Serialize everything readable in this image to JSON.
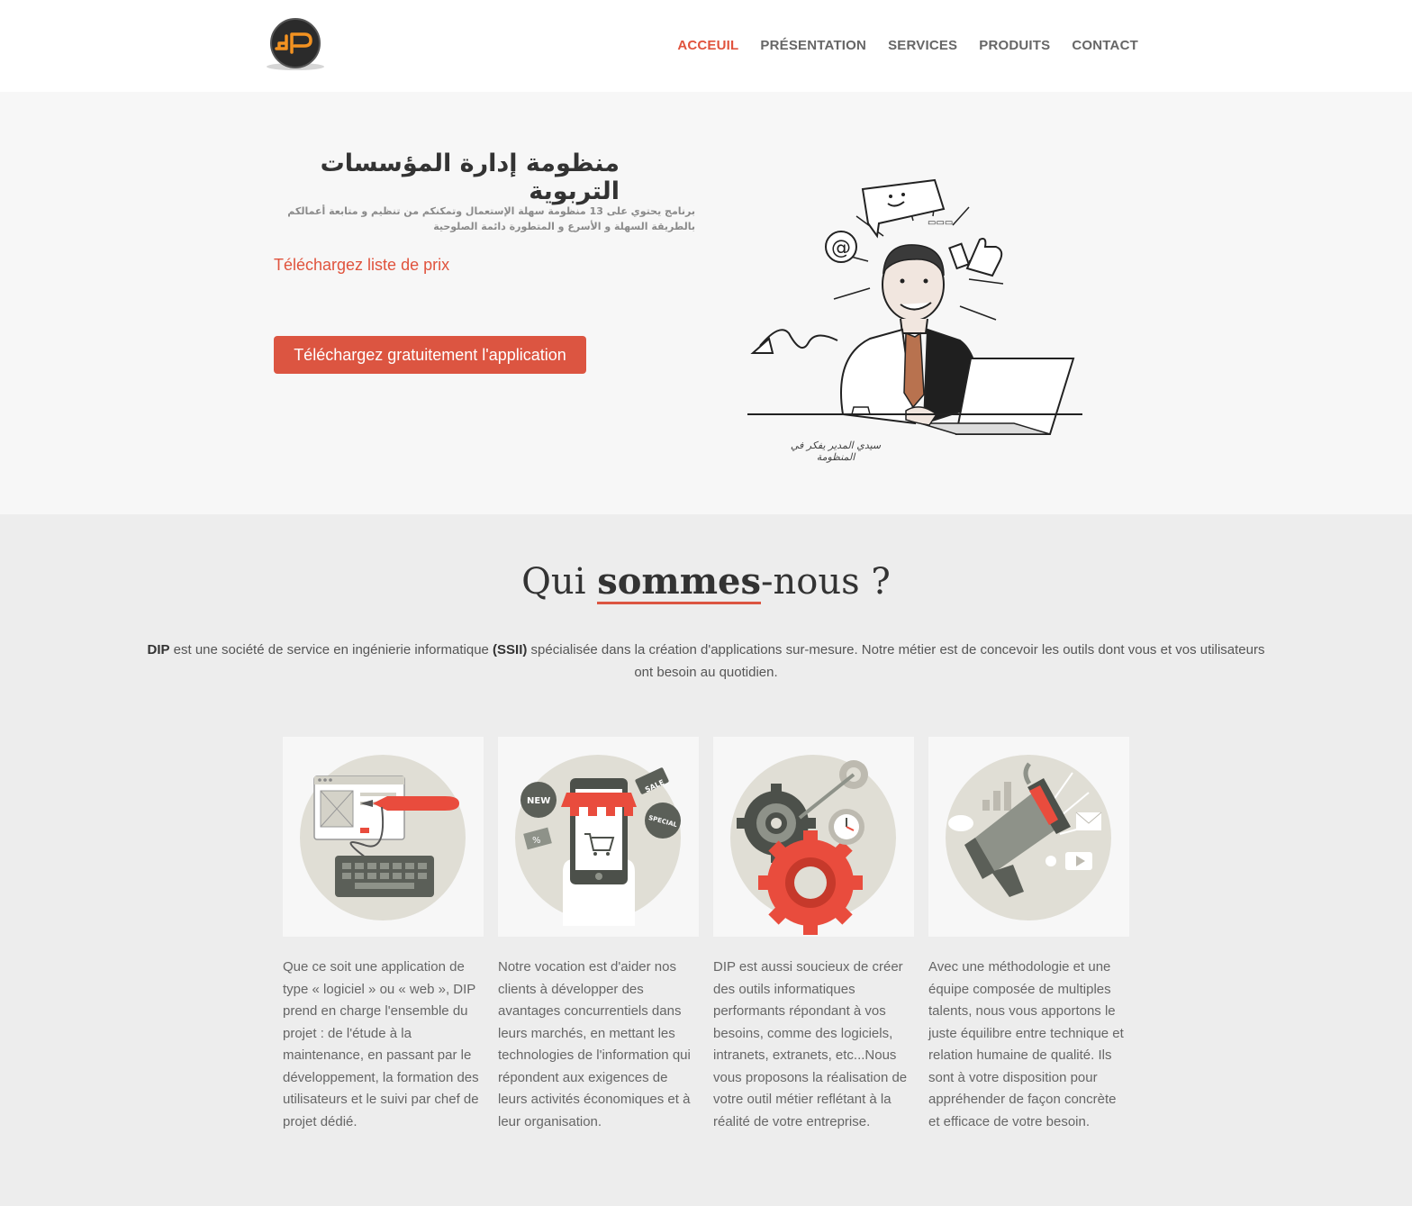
{
  "header": {
    "logo_text": "dP",
    "nav": [
      {
        "label": "ACCEUIL",
        "active": true
      },
      {
        "label": "PRÉSENTATION",
        "active": false
      },
      {
        "label": "SERVICES",
        "active": false
      },
      {
        "label": "PRODUITS",
        "active": false
      },
      {
        "label": "CONTACT",
        "active": false
      }
    ]
  },
  "hero": {
    "title": "منظومة إدارة المؤسسات التربوية",
    "subtitle": "برنامج يحتوي على 13 منظومة سهلة الإستعمال وتمكنكم من تنظيم و متابعة أعمالكم بالطريقة السهلة و الأسرع و المتطورة دائمة الصلوحية",
    "price_link": "Téléchargez liste de prix",
    "cta_button": "Téléchargez gratuitement l'application",
    "illustration_caption": "سيدي المدير يفكر في المنظومة"
  },
  "about": {
    "title_pre": "Qui ",
    "title_bold": "sommes",
    "title_post": "-nous ?",
    "intro_dip": "DIP",
    "intro_part1": " est une société de service en ingénierie informatique ",
    "intro_ssii": "(SSII)",
    "intro_part2": " spécialisée dans la création d'applications sur-mesure. Notre métier est de concevoir les outils dont vous et vos utilisateurs ont besoin au quotidien.",
    "cards": [
      {
        "icon": "web-design-icon",
        "text": "Que ce soit une application de type « logiciel » ou « web », DIP prend en charge l'ensemble du projet : de l'étude à la maintenance, en passant par le développement, la formation des utilisateurs et le suivi par chef de projet dédié."
      },
      {
        "icon": "mobile-shop-icon",
        "text": "Notre vocation est d'aider nos clients à développer des avantages concurrentiels dans leurs marchés, en mettant les technologies de l'information qui répondent aux exigences de leurs activités économiques et à leur organisation."
      },
      {
        "icon": "gears-icon",
        "text": "DIP est aussi soucieux de créer des outils informatiques performants répondant à vos besoins, comme des logiciels, intranets, extranets, etc...Nous vous proposons la réalisation de votre outil métier reflétant à la réalité de votre entreprise."
      },
      {
        "icon": "megaphone-icon",
        "text": "Avec une méthodologie et une équipe composée de multiples talents, nous vous apportons le juste équilibre entre technique et relation humaine de qualité. Ils sont à votre disposition pour appréhender de façon concrète et efficace de votre besoin."
      }
    ],
    "card_badges": {
      "new": "NEW",
      "sale": "SALE",
      "special": "SPECIAL",
      "percent": "%"
    }
  },
  "colors": {
    "accent": "#dc5541",
    "hero_bg": "#f7f7f7",
    "section_bg": "#ededed"
  }
}
